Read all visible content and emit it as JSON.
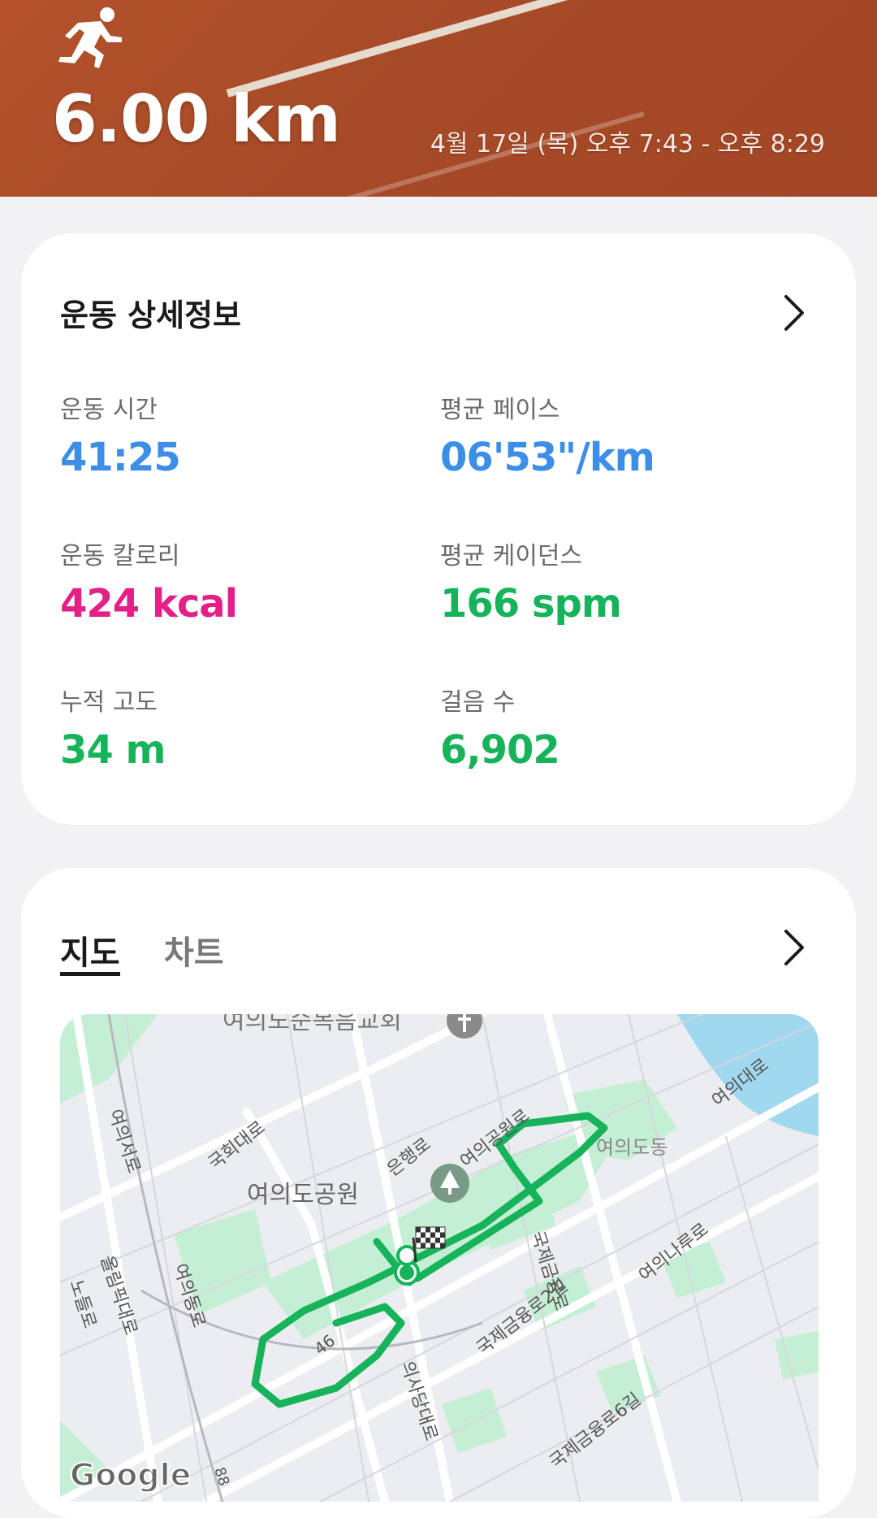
{
  "header": {
    "icon": "running-icon",
    "distance": "6.00 km",
    "datetime": "4월 17일 (목) 오후 7:43 - 오후 8:29"
  },
  "details": {
    "title": "운동 상세정보",
    "stats": [
      {
        "label": "운동 시간",
        "value": "41:25",
        "color": "#3d8ee6"
      },
      {
        "label": "평균 페이스",
        "value": "06'53\"/km",
        "color": "#3d8ee6"
      },
      {
        "label": "운동 칼로리",
        "value": "424 kcal",
        "color": "#e41f86"
      },
      {
        "label": "평균 케이던스",
        "value": "166 spm",
        "color": "#17b35a"
      },
      {
        "label": "누적 고도",
        "value": "34 m",
        "color": "#17b35a"
      },
      {
        "label": "걸음 수",
        "value": "6,902",
        "color": "#17b35a"
      }
    ]
  },
  "map_card": {
    "tabs": [
      {
        "label": "지도",
        "selected": true
      },
      {
        "label": "차트",
        "selected": false
      }
    ],
    "map_labels": {
      "church": "여의도순복음교회",
      "yeouidaero": "여의대로",
      "yeouiseoro": "여의서로",
      "gukhoedaero": "국회대로",
      "eunhaengro": "은행로",
      "yeouigongwonro": "여의공원로",
      "yeouidodong": "여의도동",
      "park": "여의도공원",
      "noduljo": "노들로",
      "olympicdaero": "올림픽대로",
      "yeouidongro": "여의동로",
      "gukjegeumyungro": "국제금융로",
      "yeouinaruro": "여의나루로",
      "gukjegeumyungro2gil": "국제금융로2길",
      "uisadangdaero": "의사당대로",
      "gukjegeumyungro6gil": "국제금융로6길",
      "road46": "46",
      "road88": "88",
      "google": "Google"
    },
    "route_color": "#17b35a"
  }
}
